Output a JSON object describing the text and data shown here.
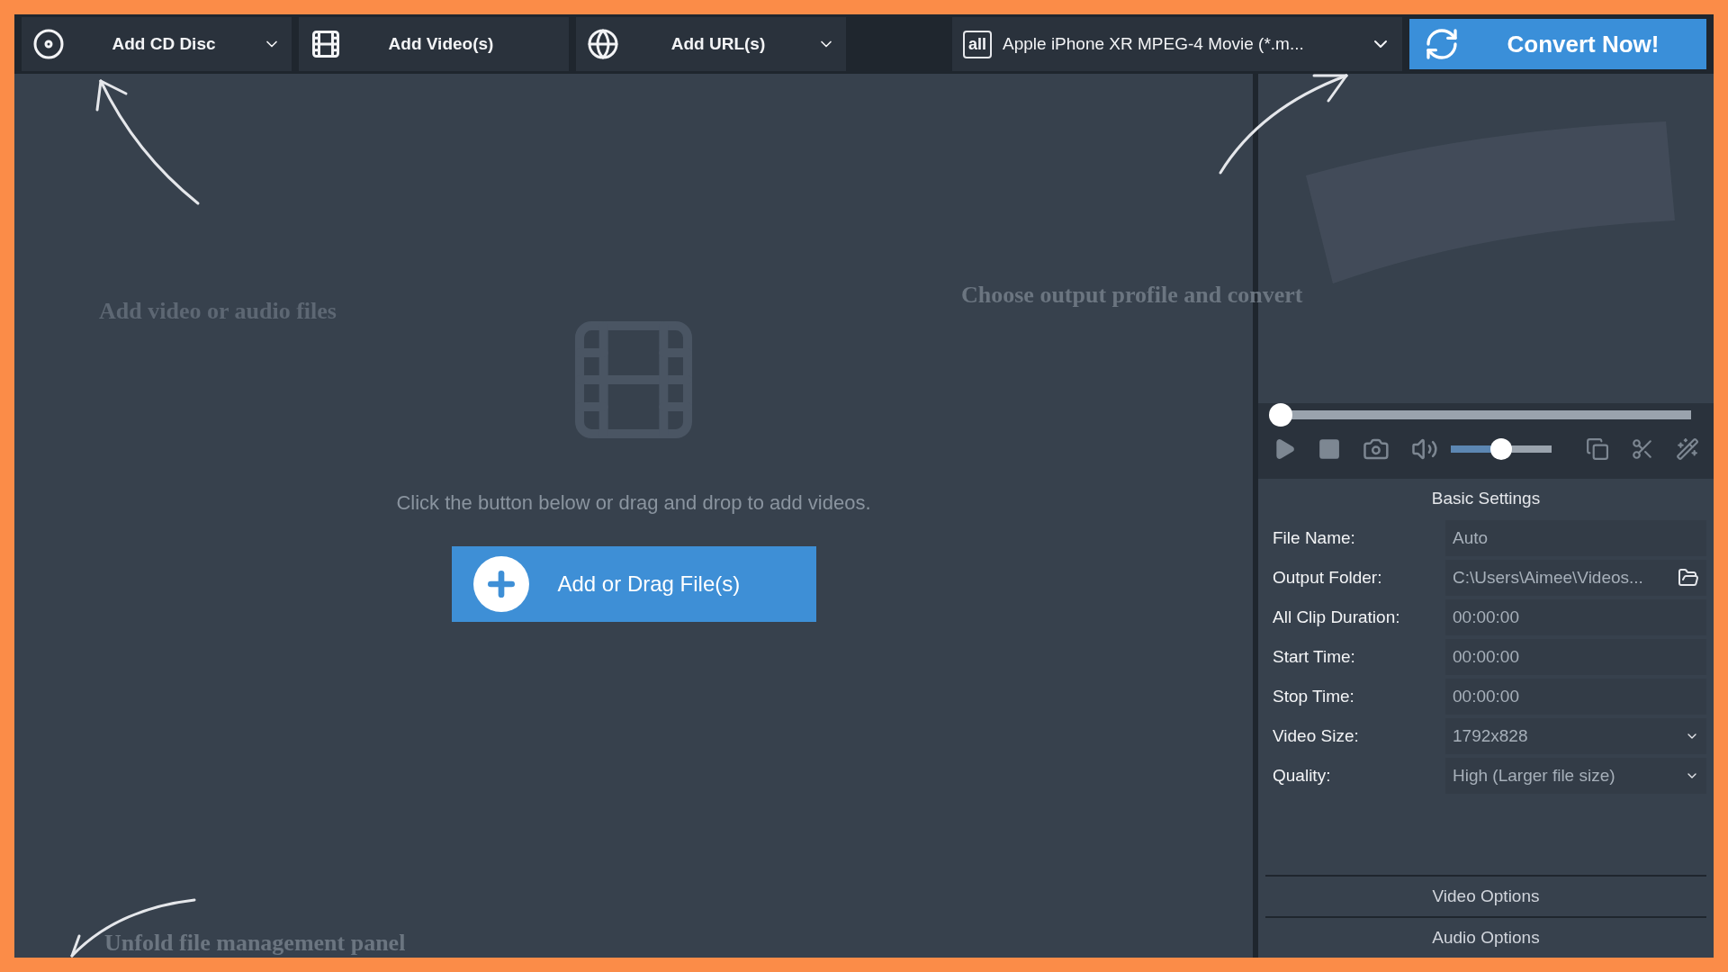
{
  "toolbar": {
    "buttons": [
      {
        "label": "Add CD Disc",
        "kind": "disc",
        "dropdown": true
      },
      {
        "label": "Add Video(s)",
        "kind": "video",
        "dropdown": false
      },
      {
        "label": "Add URL(s)",
        "kind": "url",
        "dropdown": true
      }
    ],
    "profile": {
      "badge": "all",
      "label": "Apple iPhone XR MPEG-4 Movie (*.m..."
    },
    "convert": "Convert Now!"
  },
  "dropzone": {
    "message": "Click the button below or drag and drop to add videos.",
    "button": "Add or Drag File(s)"
  },
  "player": {
    "seek": {
      "level": 0
    },
    "volume": {
      "level": 0.5
    }
  },
  "settings": {
    "title": "Basic Settings",
    "rows": [
      {
        "label": "File Name:",
        "value": "Auto",
        "kind": "text"
      },
      {
        "label": "Output Folder:",
        "value": "C:\\Users\\Aimee\\Videos...",
        "kind": "folder"
      },
      {
        "label": "All Clip Duration:",
        "value": "00:00:00",
        "kind": "text"
      },
      {
        "label": "Start Time:",
        "value": "00:00:00",
        "kind": "text"
      },
      {
        "label": "Stop Time:",
        "value": "00:00:00",
        "kind": "text"
      },
      {
        "label": "Video Size:",
        "value": "1792x828",
        "kind": "dropdown"
      },
      {
        "label": "Quality:",
        "value": "High (Larger file size)",
        "kind": "dropdown"
      }
    ],
    "sections": [
      "Video Options",
      "Audio Options"
    ]
  },
  "annotations": {
    "add_files": "Add video or audio files",
    "choose_profile": "Choose output profile and convert",
    "unfold_panel": "Unfold file management panel"
  }
}
